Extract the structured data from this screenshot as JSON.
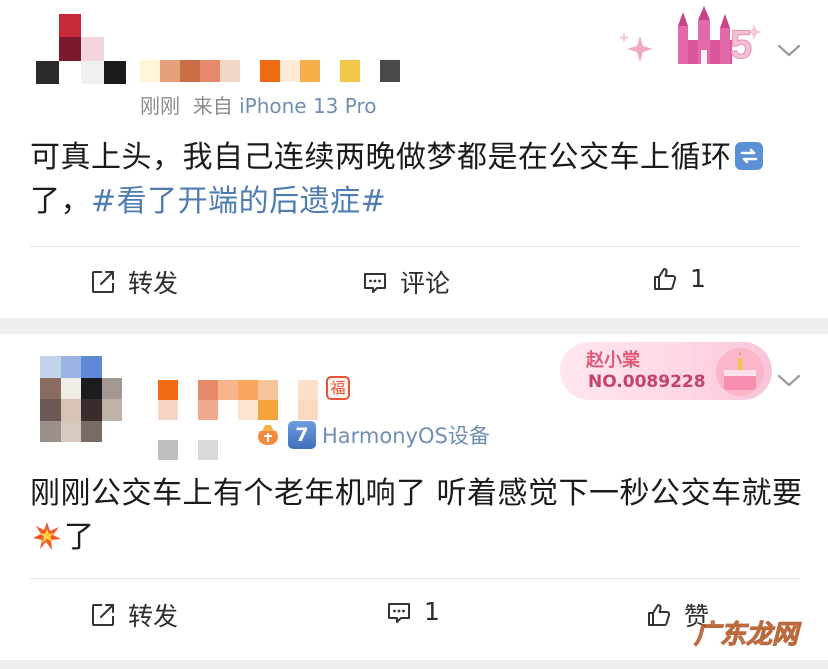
{
  "post1": {
    "timestamp": "刚刚",
    "source_prefix": "来自",
    "source_device": "iPhone 13 Pro",
    "text_before_icon": "可真上头，我自己连续两晚做梦都是在公交车上循环",
    "inline_icon": "repeat-icon",
    "text_after_icon": "了，",
    "hashtag": "#看了开端的后遗症#",
    "actions": {
      "repost_label": "转发",
      "comment_label": "评论",
      "like_count": "1"
    },
    "badge": {
      "icon": "castle-5th-anniversary-icon",
      "number": "5"
    }
  },
  "post2": {
    "fu_tag": "福",
    "level": "7",
    "device": "HarmonyOS设备",
    "text_before_icon": "刚刚公交车上有个老年机响了 听着感觉下一秒公交车就要",
    "inline_icon": "collision-icon",
    "text_after_icon": "了",
    "actions": {
      "repost_label": "转发",
      "comment_count": "1",
      "like_label": "赞"
    },
    "badge": {
      "name": "赵小棠",
      "number": "NO.0089228"
    }
  },
  "watermark": "广东龙网",
  "colors": {
    "hashtag": "#4f7cb3",
    "meta": "#8b8b8b",
    "separator": "#eeeeee"
  }
}
